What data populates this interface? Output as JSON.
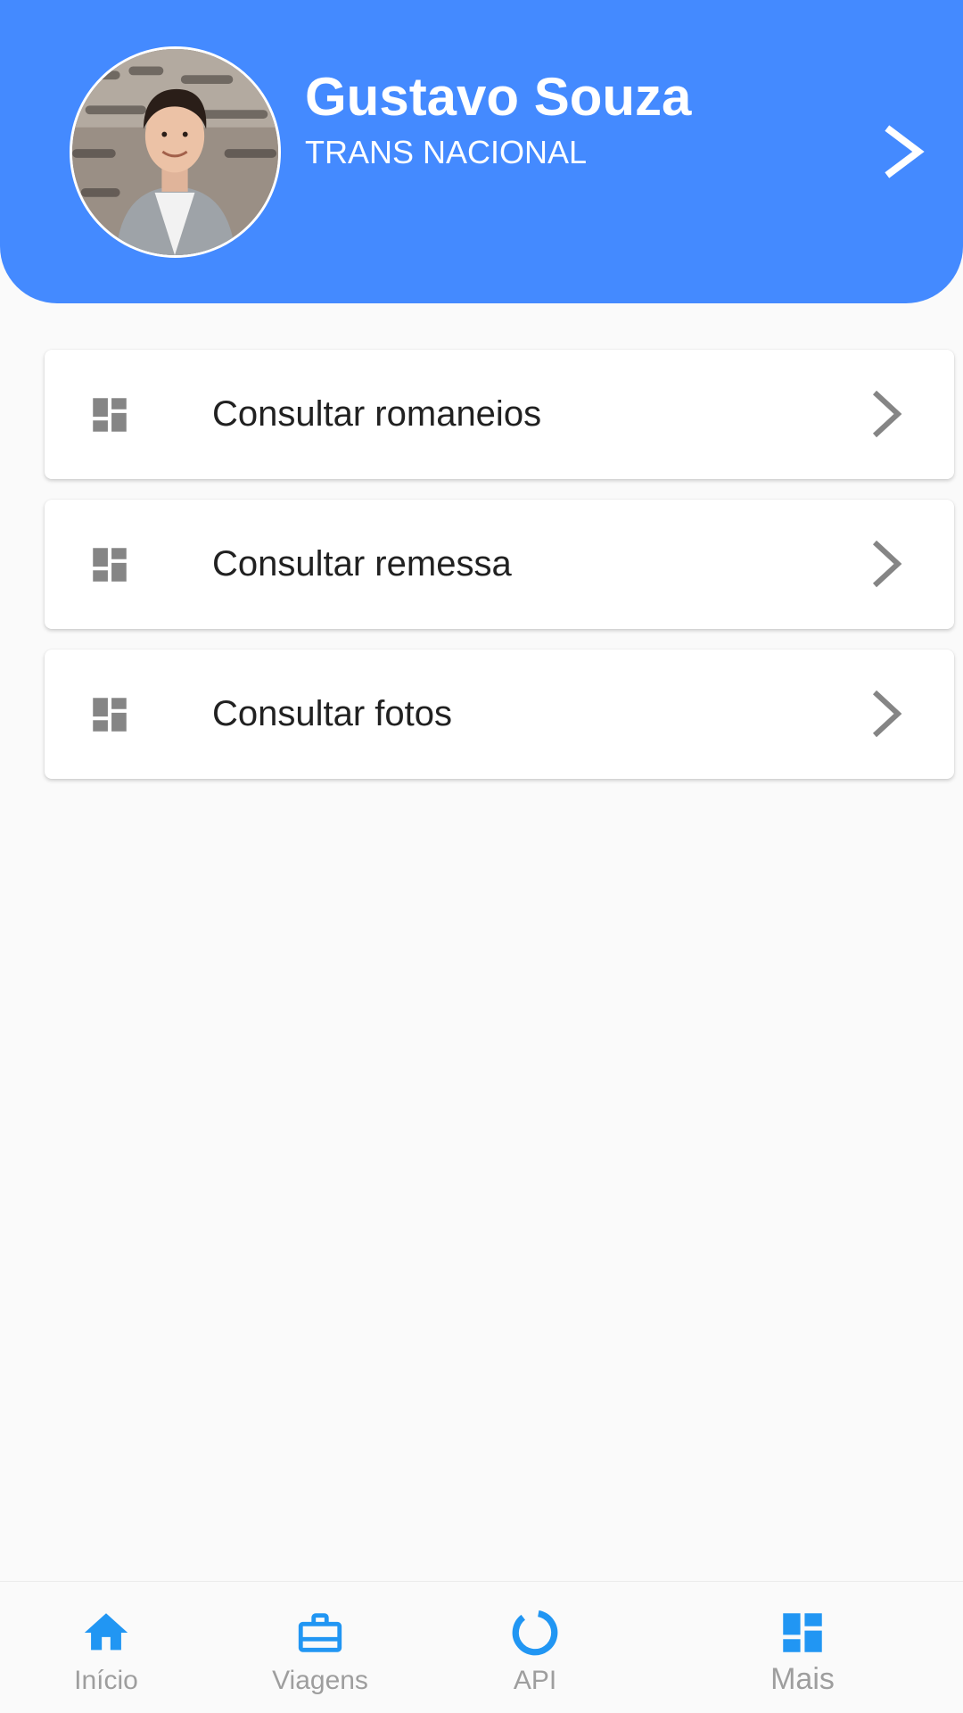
{
  "colors": {
    "primary": "#448aff",
    "nav_active": "#2196f3",
    "icon_grey": "#858585",
    "text_dark": "#212121",
    "nav_label": "#9e9e9e"
  },
  "header": {
    "user_name": "Gustavo Souza",
    "company": "TRANS NACIONAL",
    "avatar_icon": "user-photo",
    "chevron_icon": "chevron-right-icon"
  },
  "menu": {
    "items": [
      {
        "label": "Consultar romaneios",
        "icon": "dashboard-icon"
      },
      {
        "label": "Consultar remessa",
        "icon": "dashboard-icon"
      },
      {
        "label": "Consultar fotos",
        "icon": "dashboard-icon"
      }
    ]
  },
  "bottom_nav": {
    "items": [
      {
        "label": "Início",
        "icon": "home-icon"
      },
      {
        "label": "Viagens",
        "icon": "briefcase-icon"
      },
      {
        "label": "API",
        "icon": "progress-ring-icon"
      },
      {
        "label": "Mais",
        "icon": "dashboard-icon",
        "selected": true
      }
    ]
  }
}
